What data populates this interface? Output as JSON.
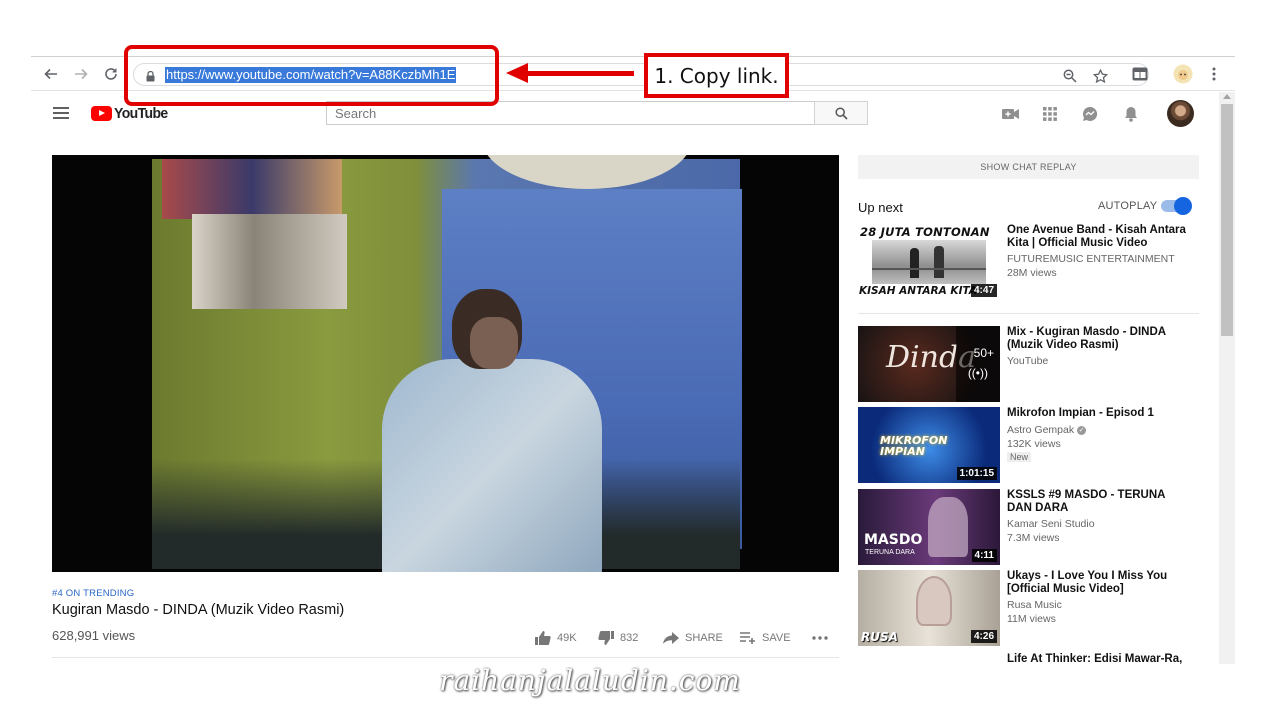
{
  "browser": {
    "url": "https://www.youtube.com/watch?v=A88KczbMh1E"
  },
  "masthead": {
    "logo_text": "YouTube",
    "search_placeholder": "Search"
  },
  "video": {
    "trending_label": "#4 ON TRENDING",
    "title": "Kugiran Masdo - DINDA (Muzik Video Rasmi)",
    "views": "628,991 views",
    "likes": "49K",
    "dislikes": "832",
    "share_label": "SHARE",
    "save_label": "SAVE"
  },
  "sidebar": {
    "chat_replay_label": "SHOW CHAT REPLAY",
    "up_next_label": "Up next",
    "autoplay_label": "AUTOPLAY",
    "autoplay_on": true,
    "recommendations": [
      {
        "thumb_top_text": "28 JUTA TONTONAN",
        "thumb_bottom_text": "KISAH ANTARA KITA",
        "title": "One Avenue Band - Kisah Antara Kita | Official Music Video",
        "channel": "FUTUREMUSIC ENTERTAINMENT",
        "views": "28M views",
        "duration": "4:47"
      },
      {
        "thumb_text": "Dinda",
        "mix_count": "50+",
        "title": "Mix - Kugiran Masdo - DINDA (Muzik Video Rasmi)",
        "channel": "YouTube"
      },
      {
        "thumb_text": "MIKROFON IMPIAN",
        "title": "Mikrofon Impian - Episod 1",
        "channel": "Astro Gempak",
        "views": "132K views",
        "badge": "New",
        "duration": "1:01:15"
      },
      {
        "thumb_text": "MASDO",
        "thumb_subtext": "TERUNA DARA",
        "title": "KSSLS #9 MASDO - TERUNA DAN DARA",
        "channel": "Kamar Seni Studio",
        "views": "7.3M views",
        "duration": "4:11"
      },
      {
        "thumb_text": "RUSA",
        "title": "Ukays - I Love You I Miss You [Official Music Video]",
        "channel": "Rusa Music",
        "views": "11M views",
        "duration": "4:26"
      },
      {
        "title": "Life At Thinker: Edisi Mawar-Ra,"
      }
    ]
  },
  "annotation": {
    "callout_text": "1. Copy link.",
    "color": "#e00000"
  },
  "watermark": "raihanjalaludin.com"
}
